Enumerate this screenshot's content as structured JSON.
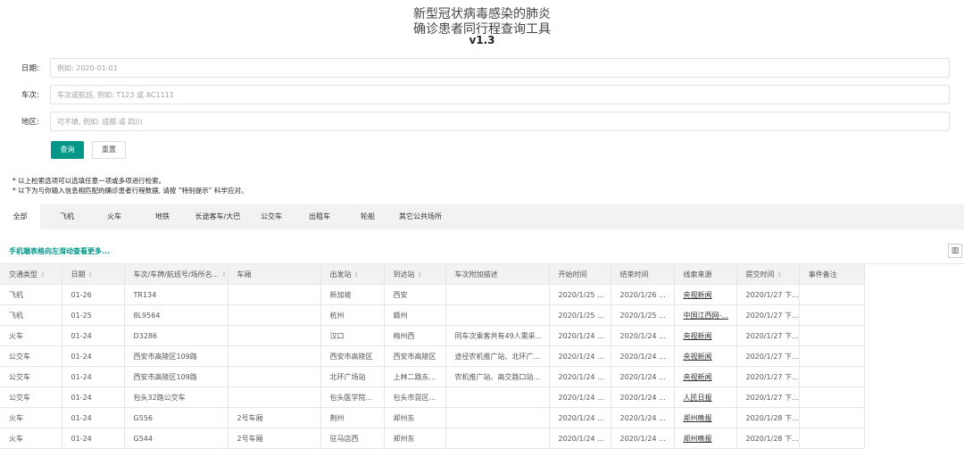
{
  "header": {
    "title_line1": "新型冠状病毒感染的肺炎",
    "title_line2": "确诊患者同行程查询工具",
    "version": "v1.3"
  },
  "form": {
    "date_label": "日期:",
    "date_placeholder": "例如: 2020-01-01",
    "train_label": "车次:",
    "train_placeholder": "车次或航班, 例如: T123 或 AC1111",
    "region_label": "地区:",
    "region_placeholder": "可不填, 例如: 成都 或 四川",
    "search_button": "查询",
    "reset_button": "重置"
  },
  "notes": [
    "* 以上检索选项可以选填任意一项或多项进行检索。",
    "* 以下为与你输入信息相匹配的确诊患者行程数据, 请按 “特别提示” 科学应对。"
  ],
  "tabs": [
    "全部",
    "飞机",
    "火车",
    "地铁",
    "长途客车/大巴",
    "公交车",
    "出租车",
    "轮船",
    "其它公共场所"
  ],
  "mobile_tip": "手机端表格向左滑动查看更多...",
  "colors": {
    "accent": "#009688",
    "header_bg": "#f2f2f2",
    "border": "#e6e6e6"
  },
  "table": {
    "headers": [
      "交通类型",
      "日期",
      "车次/车牌/航班号/场所名...",
      "车厢",
      "出发站",
      "到达站",
      "车次附加描述",
      "开始时间",
      "结束时间",
      "线索来源",
      "提交时间",
      "事件备注"
    ],
    "sortable": [
      true,
      true,
      true,
      false,
      true,
      true,
      false,
      false,
      false,
      false,
      true,
      false
    ],
    "rows": [
      [
        "飞机",
        "01-26",
        "TR134",
        "",
        "新加坡",
        "西安",
        "",
        "2020/1/25 ...",
        "2020/1/26 ...",
        "央视新闻",
        "2020/1/27 下...",
        ""
      ],
      [
        "飞机",
        "01-25",
        "8L9564",
        "",
        "杭州",
        "赣州",
        "",
        "2020/1/25 ...",
        "2020/1/25 ...",
        "中国江西网-...",
        "2020/1/27 下...",
        ""
      ],
      [
        "火车",
        "01-24",
        "D3286",
        "",
        "汉口",
        "梅州西",
        "同车次乘客共有49人需采...",
        "2020/1/24 ...",
        "2020/1/24 ...",
        "央视新闻",
        "2020/1/27 下...",
        ""
      ],
      [
        "公交车",
        "01-24",
        "西安市高陵区109路",
        "",
        "西安市高陵区",
        "西安市高陵区",
        "途径农机推广站、北环广...",
        "2020/1/24 ...",
        "2020/1/24 ...",
        "央视新闻",
        "2020/1/27 下...",
        ""
      ],
      [
        "公交车",
        "01-24",
        "西安市高陵区109路",
        "",
        "北环广场站",
        "上林二路东...",
        "农机推广站、高交路口站...",
        "2020/1/24 ...",
        "2020/1/24 ...",
        "央视新闻",
        "2020/1/27 下...",
        ""
      ],
      [
        "公交车",
        "01-24",
        "包头32路公交车",
        "",
        "包头医学院...",
        "包头市昆区...",
        "",
        "2020/1/24 ...",
        "2020/1/24 ...",
        "人民日报",
        "2020/1/27 下...",
        ""
      ],
      [
        "火车",
        "01-24",
        "G556",
        "2号车厢",
        "荆州",
        "郑州东",
        "",
        "2020/1/24 ...",
        "2020/1/24 ...",
        "郑州晚报",
        "2020/1/28 下...",
        ""
      ],
      [
        "火车",
        "01-24",
        "G544",
        "2号车厢",
        "驻马店西",
        "郑州东",
        "",
        "2020/1/24 ...",
        "2020/1/24 ...",
        "郑州晚报",
        "2020/1/28 下...",
        ""
      ]
    ]
  }
}
